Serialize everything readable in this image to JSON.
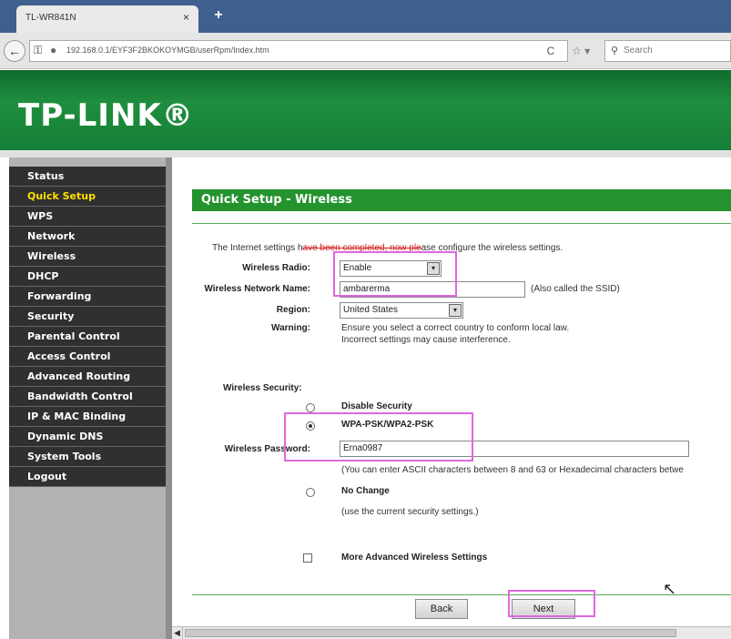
{
  "browser": {
    "tab_title": "TL-WR841N",
    "tab_close": "×",
    "new_tab": "+",
    "url": "192.168.0.1/EYF3F2BKOKOYMGB/userRpm/Index.htm",
    "search_placeholder": "Search",
    "icons": [
      "back-arrow-icon",
      "key-icon",
      "lock-icon",
      "reload-icon",
      "star-icon",
      "search-icon"
    ]
  },
  "banner": {
    "brand": "TP-LINK®"
  },
  "menu": {
    "items": [
      {
        "label": "Status"
      },
      {
        "label": "Quick Setup",
        "active": true
      },
      {
        "label": "WPS"
      },
      {
        "label": "Network"
      },
      {
        "label": "Wireless"
      },
      {
        "label": "DHCP"
      },
      {
        "label": "Forwarding"
      },
      {
        "label": "Security"
      },
      {
        "label": "Parental Control"
      },
      {
        "label": "Access Control"
      },
      {
        "label": "Advanced Routing"
      },
      {
        "label": "Bandwidth Control"
      },
      {
        "label": "IP & MAC Binding"
      },
      {
        "label": "Dynamic DNS"
      },
      {
        "label": "System Tools"
      },
      {
        "label": "Logout"
      }
    ]
  },
  "page": {
    "title": "Quick Setup - Wireless",
    "intro_a": "The Internet settings h",
    "intro_strike": "ave been completed, now ple",
    "intro_b": "ase configure the wireless settings.",
    "wireless_radio_label": "Wireless Radio:",
    "wireless_radio_value": "Enable",
    "ssid_label": "Wireless Network Name:",
    "ssid_value": "ambarerma",
    "ssid_note": "(Also called the SSID)",
    "region_label": "Region:",
    "region_value": "United States",
    "warning_label": "Warning:",
    "warning_line1": "Ensure you select a correct country to conform local law.",
    "warning_line2": "Incorrect settings may cause interference.",
    "security_label": "Wireless Security:",
    "opt_disable": "Disable Security",
    "opt_wpa": "WPA-PSK/WPA2-PSK",
    "password_label": "Wireless Password:",
    "password_value": "Erna0987",
    "password_hint": "(You can enter ASCII characters between 8 and 63 or Hexadecimal characters betwe",
    "opt_nochange": "No Change",
    "nochange_note": "(use the current security settings.)",
    "more_settings": "More Advanced Wireless Settings",
    "back_label": "Back",
    "next_label": "Next",
    "selected_security": "WPA-PSK/WPA2-PSK",
    "dropdown_glyph": "▾"
  },
  "colors": {
    "banner_green": "#1f8e3f",
    "title_green": "#24932e",
    "menu_bg": "#303030",
    "menu_active": "#ffe000",
    "highlight": "#e066e0"
  }
}
